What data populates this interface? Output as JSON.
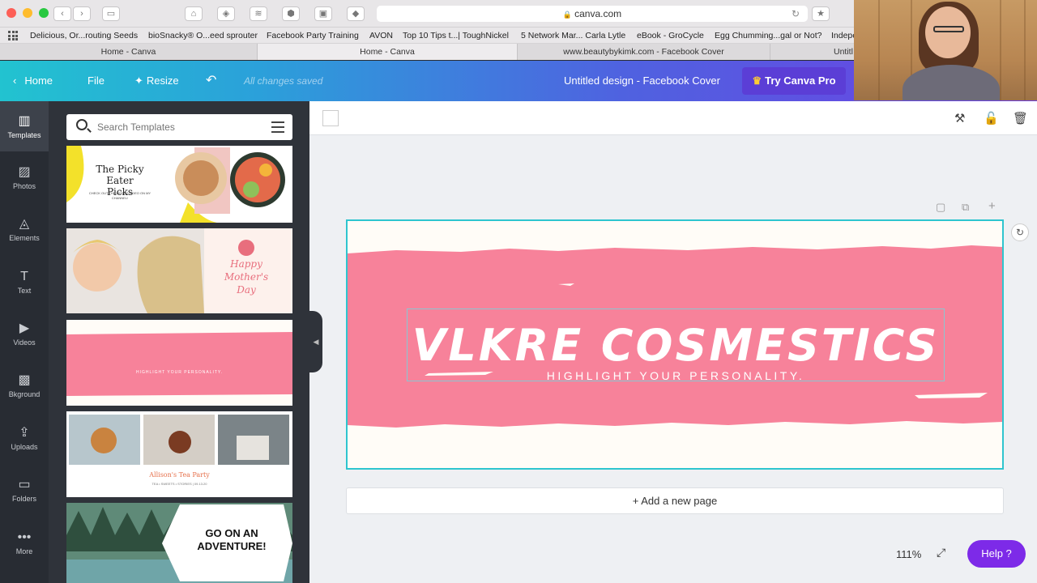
{
  "browser": {
    "url": "canva.com",
    "bookmarks": [
      "Delicious, Or...routing Seeds",
      "bioSnacky® O...eed sprouter",
      "Facebook Party Training",
      "AVON",
      "Top 10 Tips t...| ToughNickel",
      "5 Network Mar... Carla Lytle",
      "eBook - GroCycle",
      "Egg Chumming...gal or Not?",
      "Indepe"
    ],
    "tabs": [
      "Home - Canva",
      "Home - Canva",
      "www.beautybykimk.com - Facebook Cover",
      "Untitl"
    ]
  },
  "header": {
    "home": "Home",
    "file": "File",
    "resize": "Resize",
    "status": "All changes saved",
    "doc_title": "Untitled design - Facebook Cover",
    "pro": "Try Canva Pro"
  },
  "rail": {
    "items": [
      "Templates",
      "Photos",
      "Elements",
      "Text",
      "Videos",
      "Bkground",
      "Uploads",
      "Folders",
      "More"
    ]
  },
  "panel": {
    "search_placeholder": "Search Templates",
    "templates": [
      {
        "title": "The Picky Eater Picks",
        "sub": "CHECK OUT THE LATEST VIDEO ON MY CHANNEL!"
      },
      {
        "title": "Happy Mother's Day",
        "sub": ""
      },
      {
        "title": "",
        "sub": "HIGHLIGHT YOUR PERSONALITY."
      },
      {
        "title": "Allison's Tea Party",
        "sub": "TEA • SWEETS • STORIES | 09.13.20"
      },
      {
        "title": "GO ON AN ADVENTURE!",
        "sub": ""
      }
    ]
  },
  "design": {
    "title": "VLKRE COSMESTICS",
    "subtitle": "HIGHLIGHT YOUR PERSONALITY."
  },
  "workspace": {
    "add_page": "+ Add a new page",
    "zoom": "111%",
    "help": "Help ?"
  },
  "colors": {
    "brush_pink": "#f7829a",
    "selection": "#2ec5cf",
    "help_purple": "#7d2ae8"
  }
}
